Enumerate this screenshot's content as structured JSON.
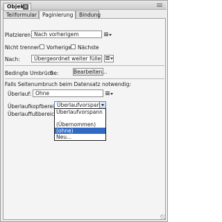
{
  "panel": {
    "title": "Objekt",
    "close_glyph": "✕",
    "tabs": [
      "Teilformular",
      "Paginierung",
      "Bindung"
    ],
    "active_tab": "Paginierung"
  },
  "pagination": {
    "placement_label": "Platzieren:",
    "placement_value": "Nach vorherigem",
    "keep_label": "Nicht trennen:",
    "keep_previous_label": "Vorherige",
    "keep_next_label": "Nächste",
    "after_label": "Nach:",
    "after_value": "Übergeordnet weiter füllen",
    "conditional_breaks_label": "Bedingte Umbrüche:",
    "conditional_breaks_count": "0",
    "edit_button": "Bearbeiten...",
    "overflow_section_label": "Falls Seitenumbruch beim Datensatz notwendig:",
    "overflow_label": "Überlauf:",
    "overflow_value": "Ohne",
    "overflow_leader_label": "Überlaufkopfbereich:",
    "overflow_leader_value": "Überlaufvorspann",
    "overflow_trailer_label": "Überlauffußbereich:"
  },
  "dropdown_options": [
    "Überlaufvorspann",
    "",
    "(Übernommen)",
    "(ohne)",
    "Neu..."
  ],
  "dropdown_selected_index": 3,
  "colors": {
    "selection": "#316ac5",
    "panel_bg": "#ececec"
  },
  "icons": [
    "close-icon",
    "panel-menu-icon",
    "list-menu-icon",
    "chevron-down-icon"
  ]
}
